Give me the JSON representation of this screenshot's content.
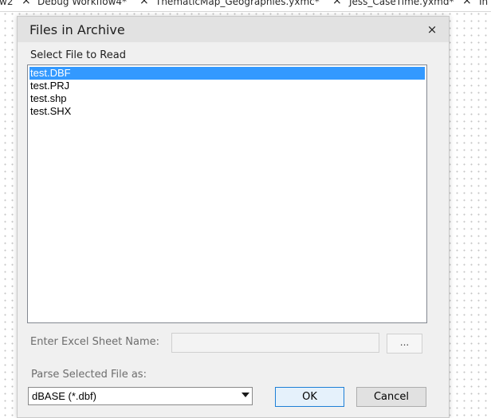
{
  "background_tabs": [
    {
      "label": "w2"
    },
    {
      "label": "Debug Workflow4*"
    },
    {
      "label": "ThematicMap_Geographies.yxmc*"
    },
    {
      "label": "Jess_CaseTime.yxmd*"
    },
    {
      "label": "In"
    }
  ],
  "dialog": {
    "title": "Files in Archive",
    "close_glyph": "×",
    "select_label": "Select File to Read",
    "files": [
      {
        "name": "test.DBF",
        "selected": true
      },
      {
        "name": "test.PRJ",
        "selected": false
      },
      {
        "name": "test.shp",
        "selected": false
      },
      {
        "name": "test.SHX",
        "selected": false
      }
    ],
    "sheet_label": "Enter Excel Sheet Name:",
    "sheet_value": "",
    "browse_label": "...",
    "parse_label": "Parse Selected File as:",
    "parse_value": "dBASE (*.dbf)",
    "ok_label": "OK",
    "cancel_label": "Cancel"
  },
  "colors": {
    "selection": "#3399ff",
    "ok_border": "#1e7fd6",
    "dialog_bg": "#f0f0f0"
  }
}
